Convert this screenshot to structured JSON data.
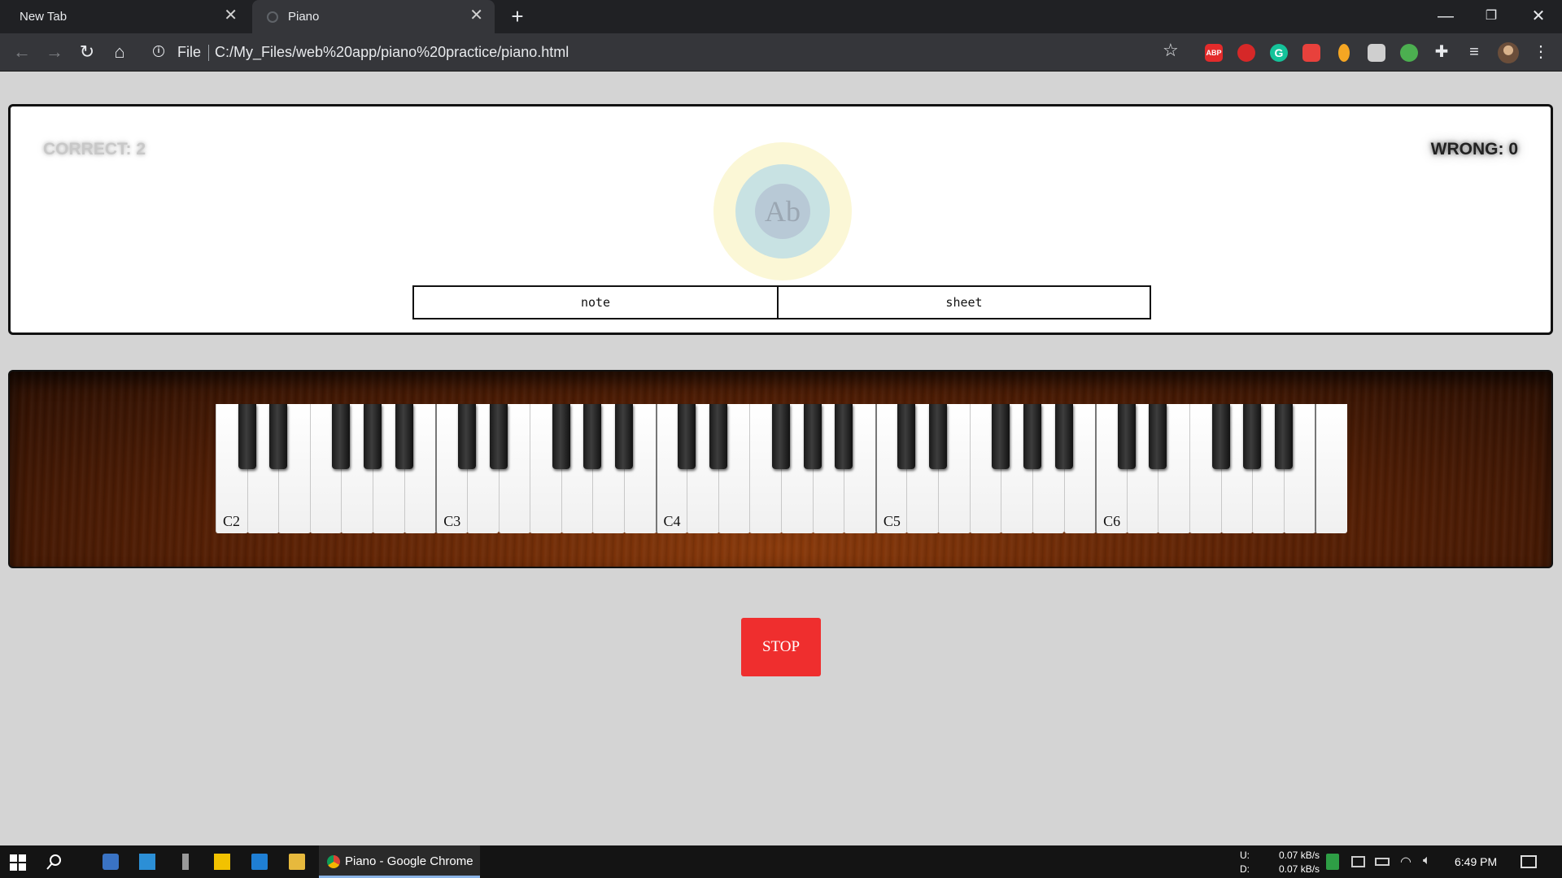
{
  "browser": {
    "tabs": [
      {
        "label": "New Tab",
        "active": false
      },
      {
        "label": "Piano",
        "active": true
      }
    ],
    "scheme_label": "File",
    "url": "C:/My_Files/web%20app/piano%20practice/piano.html",
    "extensions": [
      {
        "name": "adblock-plus-icon",
        "text": "ABP",
        "color": "#e32b2b"
      },
      {
        "name": "hand-stop-icon",
        "text": "",
        "color": "#d62828"
      },
      {
        "name": "grammarly-icon",
        "text": "G",
        "color": "#15c39a"
      },
      {
        "name": "stack-icon",
        "text": "",
        "color": "#e8413c"
      },
      {
        "name": "bulb-icon",
        "text": "",
        "color": "#f5a623"
      },
      {
        "name": "shield-icon",
        "text": "",
        "color": "#cfcfcf"
      },
      {
        "name": "colorful-ext-icon",
        "text": "",
        "color": "#4caf50"
      }
    ]
  },
  "score": {
    "correct": "CORRECT: 2",
    "wrong": "WRONG: 0"
  },
  "current_note": "Ab",
  "mode_tabs": [
    "note",
    "sheet"
  ],
  "piano": {
    "octave_labels": [
      "C2",
      "C3",
      "C4",
      "C5",
      "C6"
    ]
  },
  "stop_button": "STOP",
  "taskbar": {
    "active_app": "Piano - Google Chrome",
    "upload_label": "U:",
    "download_label": "D:",
    "upload_speed": "0.07 kB/s",
    "download_speed": "0.07 kB/s",
    "time": "6:49 PM"
  }
}
